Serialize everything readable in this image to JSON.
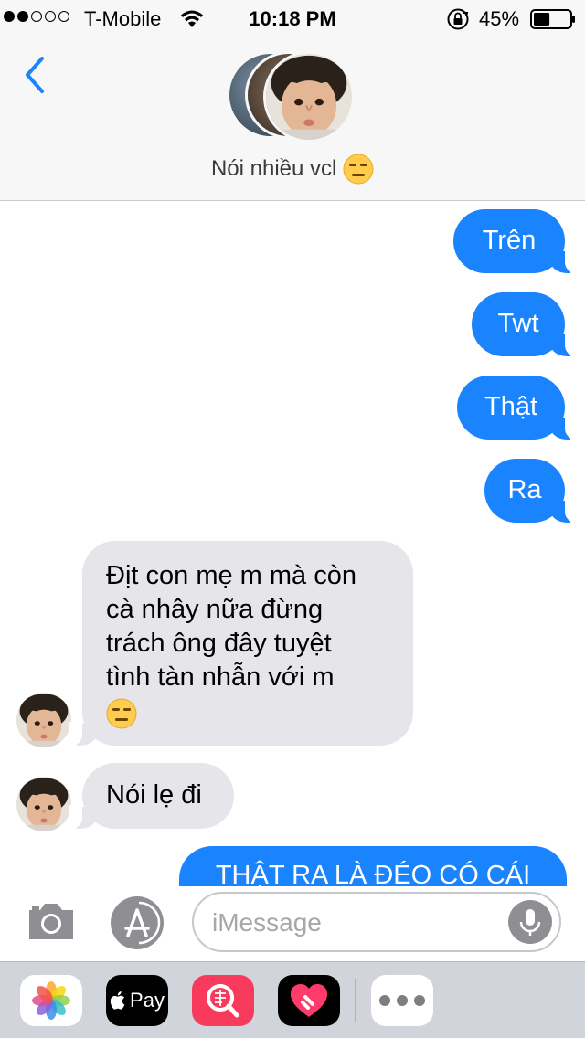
{
  "status_bar": {
    "carrier": "T-Mobile",
    "time": "10:18 PM",
    "battery_percent": "45%",
    "battery_level": 0.45,
    "signal_dots_filled": 2,
    "signal_dots_total": 5,
    "icons": [
      "wifi-icon",
      "orientation-lock-icon",
      "battery-icon"
    ]
  },
  "header": {
    "back_icon": "chevron-left-icon",
    "group_name": "Nói nhiều vcl",
    "group_emoji": "expressionless-face-emoji"
  },
  "messages": [
    {
      "direction": "outgoing",
      "text": "Trên"
    },
    {
      "direction": "outgoing",
      "text": "Twt"
    },
    {
      "direction": "outgoing",
      "text": "Thật"
    },
    {
      "direction": "outgoing",
      "text": "Ra"
    },
    {
      "direction": "incoming",
      "lines": [
        "Địt con mẹ m mà còn",
        "cà nhây nữa đừng",
        "trách ông đây tuyệt",
        "tình tàn nhẫn với m"
      ],
      "emoji": "expressionless-face-emoji"
    },
    {
      "direction": "incoming",
      "text": "Nói lẹ đi"
    },
    {
      "direction": "outgoing",
      "text": "THẬT RA LÀ ĐÉO CÓ CÁI",
      "partially_visible": true
    }
  ],
  "input_bar": {
    "placeholder": "iMessage",
    "value": "",
    "icons": [
      "camera-icon",
      "app-store-icon",
      "microphone-icon"
    ]
  },
  "app_drawer": {
    "apps": [
      {
        "name": "Photos",
        "icon": "photos-icon"
      },
      {
        "name": "Apple Pay",
        "label": "Pay",
        "icon": "apple-pay-icon"
      },
      {
        "name": "Image Search",
        "icon": "image-search-icon"
      },
      {
        "name": "Digital Touch",
        "icon": "digital-touch-icon"
      },
      {
        "name": "More",
        "icon": "more-icon"
      }
    ]
  },
  "colors": {
    "outgoing_bubble": "#1a84ff",
    "incoming_bubble": "#e5e5ea",
    "accent": "#1a84ff",
    "header_bg": "#f7f7f7",
    "drawer_bg": "#d1d4da"
  }
}
